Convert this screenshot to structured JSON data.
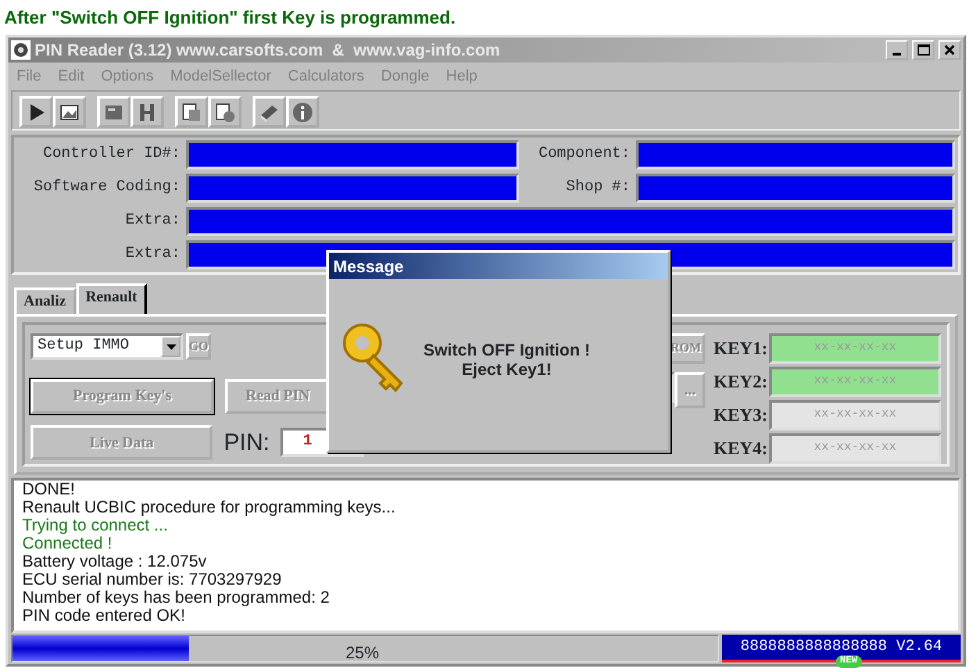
{
  "caption": "After \"Switch OFF Ignition\" first Key is programmed.",
  "window": {
    "title": "PIN Reader (3.12) www.carsofts.com  &  www.vag-info.com",
    "active": false
  },
  "menu": [
    "File",
    "Edit",
    "Options",
    "ModelSellector",
    "Calculators",
    "Dongle",
    "Help"
  ],
  "fields": [
    {
      "label": "Controller ID#:",
      "wide": false
    },
    {
      "label": "Component:",
      "wide": false
    },
    {
      "label": "Software Coding:",
      "wide": false
    },
    {
      "label": "Shop #:",
      "wide": false
    },
    {
      "label": "Extra:",
      "wide": true
    },
    {
      "label": "Extra:",
      "wide": true
    }
  ],
  "tabs": [
    {
      "label": "Analiz",
      "selected": false
    },
    {
      "label": "Renault",
      "selected": true
    }
  ],
  "renault": {
    "mode": "Setup IMMO",
    "go": "GO",
    "program_keys": "Program Key's",
    "read_pin": "Read PIN",
    "live_data": "Live Data",
    "pin_label": "PIN:",
    "pin_value": "1",
    "rom": "ROM",
    "browse": "...",
    "keys": [
      {
        "label": "KEY1:",
        "value": "xx-xx-xx-xx",
        "programmed": true
      },
      {
        "label": "KEY2:",
        "value": "xx-xx-xx-xx",
        "programmed": true
      },
      {
        "label": "KEY3:",
        "value": "xx-xx-xx-xx",
        "programmed": false
      },
      {
        "label": "KEY4:",
        "value": "xx-xx-xx-xx",
        "programmed": false
      }
    ]
  },
  "log": [
    {
      "text": "DONE!",
      "kind": "info"
    },
    {
      "text": "Renault UCBIC procedure for programming keys...",
      "kind": "info"
    },
    {
      "text": "Trying to connect ...",
      "kind": "success"
    },
    {
      "text": "Connected !",
      "kind": "success"
    },
    {
      "text": "Battery voltage : 12.075v",
      "kind": "info"
    },
    {
      "text": "ECU serial number is: 7703297929",
      "kind": "info"
    },
    {
      "text": "Number of keys has been programmed: 2",
      "kind": "info"
    },
    {
      "text": "PIN code entered OK!",
      "kind": "info"
    }
  ],
  "status_bar": {
    "level": 0.25,
    "percent": "25%",
    "version": "8888888888888888 V2.64",
    "badge": "NEW"
  },
  "dialog": {
    "title": "Message",
    "lines": [
      "Switch OFF Ignition !",
      "Eject Key1!"
    ]
  }
}
